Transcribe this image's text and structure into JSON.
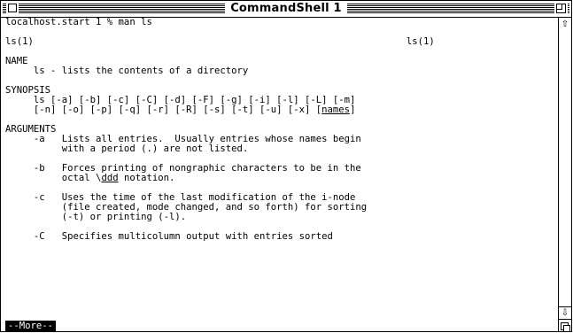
{
  "window": {
    "title": "CommandShell 1"
  },
  "terminal": {
    "lines": [
      {
        "segments": [
          {
            "text": "localhost.start 1 % man ls"
          }
        ]
      },
      {
        "segments": [
          {
            "text": ""
          }
        ]
      },
      {
        "segments": [
          {
            "text": "ls(1)                                                                  ls(1)"
          }
        ]
      },
      {
        "segments": [
          {
            "text": ""
          }
        ]
      },
      {
        "segments": [
          {
            "text": "NAME"
          }
        ]
      },
      {
        "segments": [
          {
            "text": "     ls - lists the contents of a directory"
          }
        ]
      },
      {
        "segments": [
          {
            "text": ""
          }
        ]
      },
      {
        "segments": [
          {
            "text": "SYNOPSIS"
          }
        ]
      },
      {
        "segments": [
          {
            "text": "     ls [-a] [-b] [-c] [-C] [-d] [-F] [-g] [-i] [-l] [-L] [-m]"
          }
        ]
      },
      {
        "segments": [
          {
            "text": "     [-n] [-o] [-p] [-q] [-r] [-R] [-s] [-t] [-u] [-x] ["
          },
          {
            "text": "names",
            "u": true
          },
          {
            "text": "]"
          }
        ]
      },
      {
        "segments": [
          {
            "text": ""
          }
        ]
      },
      {
        "segments": [
          {
            "text": "ARGUMENTS"
          }
        ]
      },
      {
        "segments": [
          {
            "text": "     -a   Lists all entries.  Usually entries whose names begin"
          }
        ]
      },
      {
        "segments": [
          {
            "text": "          with a period (.) are not listed."
          }
        ]
      },
      {
        "segments": [
          {
            "text": ""
          }
        ]
      },
      {
        "segments": [
          {
            "text": "     -b   Forces printing of nongraphic characters to be in the"
          }
        ]
      },
      {
        "segments": [
          {
            "text": "          octal \\"
          },
          {
            "text": "ddd",
            "u": true
          },
          {
            "text": " notation."
          }
        ]
      },
      {
        "segments": [
          {
            "text": ""
          }
        ]
      },
      {
        "segments": [
          {
            "text": "     -c   Uses the time of the last modification of the i-node"
          }
        ]
      },
      {
        "segments": [
          {
            "text": "          (file created, mode changed, and so forth) for sorting"
          }
        ]
      },
      {
        "segments": [
          {
            "text": "          (-t) or printing (-l)."
          }
        ]
      },
      {
        "segments": [
          {
            "text": ""
          }
        ]
      },
      {
        "segments": [
          {
            "text": "     -C   Specifies multicolumn output with entries sorted"
          }
        ]
      }
    ],
    "more_prompt": "--More--"
  },
  "scrollbar": {
    "up_icon": "scroll-up-arrow-icon",
    "down_icon": "scroll-down-arrow-icon",
    "up_glyph": "⇧",
    "down_glyph": "⇩"
  }
}
